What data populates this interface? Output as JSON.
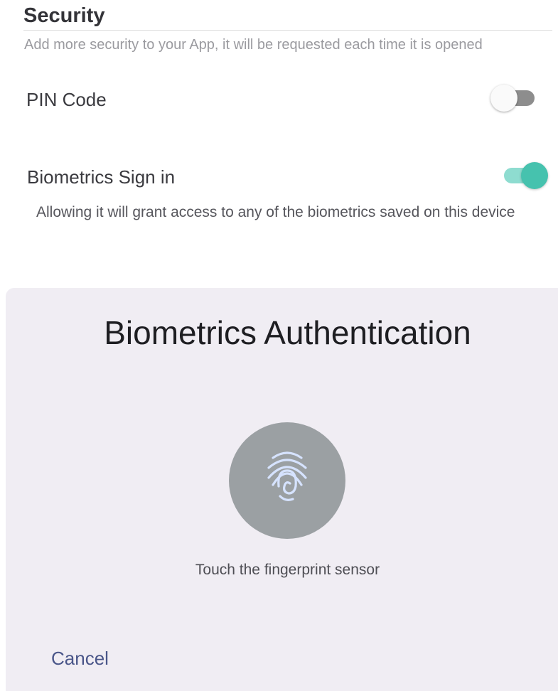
{
  "security": {
    "title": "Security",
    "description": "Add more security to your App, it will be requested each time it is opened",
    "pin_code": {
      "label": "PIN Code",
      "enabled": false
    },
    "biometrics": {
      "label": "Biometrics Sign in",
      "enabled": true,
      "description": "Allowing it will grant access to any of the biometrics saved on this device"
    }
  },
  "dialog": {
    "title": "Biometrics Authentication",
    "icon": "fingerprint-icon",
    "hint": "Touch the fingerprint sensor",
    "cancel_label": "Cancel"
  },
  "colors": {
    "accent": "#46c2ae",
    "accent_track": "#8edcd0",
    "fingerprint_circle": "#9ba0a3",
    "fingerprint_lines": "#d6e3ff",
    "cancel_text": "#4a5689",
    "sheet_background": "#f0edf3"
  }
}
